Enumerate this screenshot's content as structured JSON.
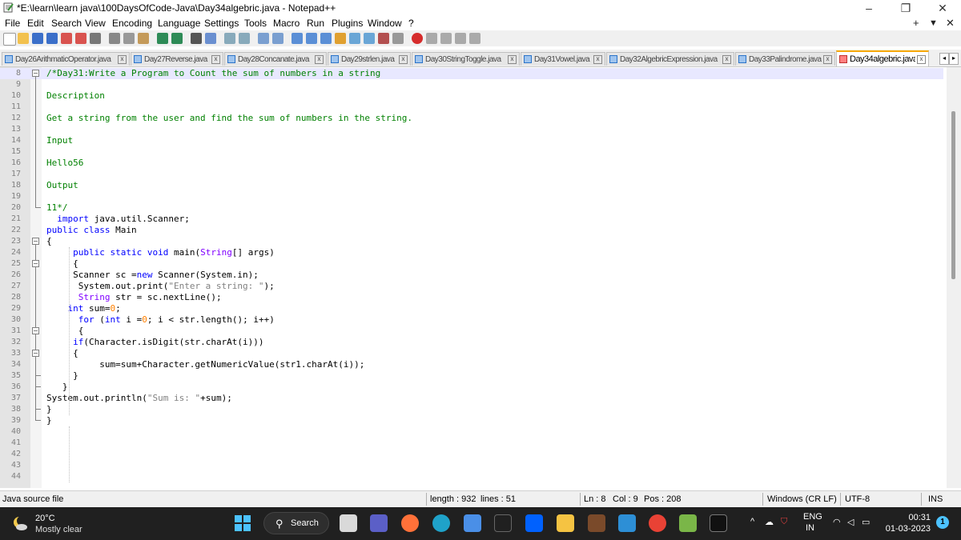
{
  "window": {
    "title": "*E:\\learn\\learn java\\100DaysOfCode-Java\\Day34algebric.java - Notepad++",
    "minimize_glyph": "–",
    "restore_glyph": "❐",
    "close_glyph": "✕"
  },
  "menubar": {
    "items": [
      "File",
      "Edit",
      "Search",
      "View",
      "Encoding",
      "Language",
      "Settings",
      "Tools",
      "Macro",
      "Run",
      "Plugins",
      "Window",
      "?"
    ],
    "right_controls": [
      "+",
      "▼",
      "✕"
    ]
  },
  "tabs": [
    {
      "label": "Day26ArithmaticOperator.java",
      "active": false
    },
    {
      "label": "Day27Reverse.java",
      "active": false
    },
    {
      "label": "Day28Concanate.java",
      "active": false
    },
    {
      "label": "Day29strlen.java",
      "active": false
    },
    {
      "label": "Day30StringToggle.java",
      "active": false
    },
    {
      "label": "Day31Vowel.java",
      "active": false
    },
    {
      "label": "Day32AlgebricExpression.java",
      "active": false
    },
    {
      "label": "Day33Palindrome.java",
      "active": false
    },
    {
      "label": "Day34algebric.java",
      "active": true
    }
  ],
  "tab_close_glyph": "x",
  "tab_nav": [
    "◂",
    "▸"
  ],
  "editor": {
    "current_line": 8,
    "lines": [
      {
        "n": "8",
        "t": "/*Day31:Write a Program to Count the sum of numbers in a string"
      },
      {
        "n": "9",
        "t": ""
      },
      {
        "n": "10",
        "t": "Description"
      },
      {
        "n": "11",
        "t": ""
      },
      {
        "n": "12",
        "t": "Get a string from the user and find the sum of numbers in the string."
      },
      {
        "n": "13",
        "t": ""
      },
      {
        "n": "14",
        "t": "Input"
      },
      {
        "n": "15",
        "t": ""
      },
      {
        "n": "16",
        "t": "Hello56"
      },
      {
        "n": "17",
        "t": ""
      },
      {
        "n": "18",
        "t": "Output"
      },
      {
        "n": "19",
        "t": ""
      },
      {
        "n": "20",
        "t": "11*/"
      },
      {
        "n": "21",
        "t": "  import java.util.Scanner;"
      },
      {
        "n": "22",
        "t": "public class Main"
      },
      {
        "n": "23",
        "t": "{"
      },
      {
        "n": "24",
        "t": "     public static void main(String[] args)"
      },
      {
        "n": "25",
        "t": "     {"
      },
      {
        "n": "26",
        "t": "     Scanner sc =new Scanner(System.in);"
      },
      {
        "n": "27",
        "t": "      System.out.print(\"Enter a string: \");"
      },
      {
        "n": "28",
        "t": "      String str = sc.nextLine();"
      },
      {
        "n": "29",
        "t": "    int sum=0;"
      },
      {
        "n": "30",
        "t": "      for (int i =0; i < str.length(); i++)"
      },
      {
        "n": "31",
        "t": "      {"
      },
      {
        "n": "32",
        "t": "     if(Character.isDigit(str.charAt(i)))"
      },
      {
        "n": "33",
        "t": "     {"
      },
      {
        "n": "34",
        "t": "          sum=sum+Character.getNumericValue(str1.charAt(i));"
      },
      {
        "n": "35",
        "t": "     }"
      },
      {
        "n": "36",
        "t": "   }"
      },
      {
        "n": "37",
        "t": "System.out.println(\"Sum is: \"+sum);"
      },
      {
        "n": "38",
        "t": "}"
      },
      {
        "n": "39",
        "t": "}"
      },
      {
        "n": "40",
        "t": ""
      },
      {
        "n": "41",
        "t": ""
      },
      {
        "n": "42",
        "t": ""
      },
      {
        "n": "43",
        "t": ""
      },
      {
        "n": "44",
        "t": ""
      }
    ]
  },
  "statusbar": {
    "file_type": "Java source file",
    "length": "length : 932",
    "lines": "lines : 51",
    "ln": "Ln : 8",
    "col": "Col : 9",
    "pos": "Pos : 208",
    "eol": "Windows (CR LF)",
    "encoding": "UTF-8",
    "mode": "INS"
  },
  "taskbar": {
    "temperature": "20°C",
    "condition": "Mostly clear",
    "search_label": "Search",
    "language_primary": "ENG",
    "language_secondary": "IN",
    "time": "00:31",
    "date": "01-03-2023",
    "notification_count": "1",
    "tray_chevron": "^"
  },
  "colors": {
    "comment": "#008000",
    "keyword": "#0000ff",
    "type": "#8000ff",
    "number": "#ff8000",
    "string": "#808080",
    "active_tab_accent": "#f7a800",
    "current_line": "#e8e8ff",
    "taskbar": "#202020"
  }
}
